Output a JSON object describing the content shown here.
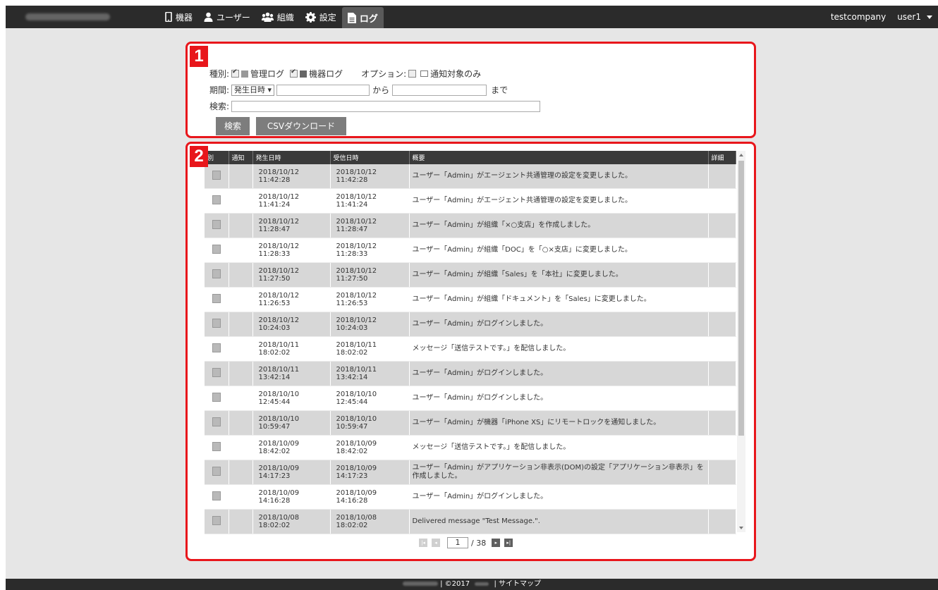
{
  "nav": {
    "items": [
      {
        "label": "機器",
        "icon": "phone-icon"
      },
      {
        "label": "ユーザー",
        "icon": "user-icon"
      },
      {
        "label": "組織",
        "icon": "group-icon"
      },
      {
        "label": "設定",
        "icon": "gear-icon"
      },
      {
        "label": "ログ",
        "icon": "document-icon"
      }
    ],
    "active": "ログ"
  },
  "user": {
    "company": "testcompany",
    "name": "user1"
  },
  "badges": {
    "panel1": "1",
    "panel2": "2"
  },
  "filter": {
    "type_label": "種別:",
    "admin_log": "管理ログ",
    "device_log": "機器ログ",
    "option_label": "オプション:",
    "notify_only": "通知対象のみ",
    "period_label": "期間:",
    "period_select": "発生日時",
    "from_label": "から",
    "to_label": "まで",
    "search_label": "検索:",
    "search_value": "",
    "search_button": "検索",
    "csv_button": "CSVダウンロード"
  },
  "table": {
    "headers": [
      "別",
      "通知",
      "発生日時",
      "受信日時",
      "概要",
      "詳細"
    ],
    "rows": [
      {
        "occ_date": "2018/10/12",
        "occ_time": "11:42:28",
        "rcv_date": "2018/10/12",
        "rcv_time": "11:42:28",
        "summary": "ユーザー「Admin」がエージェント共通管理の設定を変更しました。"
      },
      {
        "occ_date": "2018/10/12",
        "occ_time": "11:41:24",
        "rcv_date": "2018/10/12",
        "rcv_time": "11:41:24",
        "summary": "ユーザー「Admin」がエージェント共通管理の設定を変更しました。"
      },
      {
        "occ_date": "2018/10/12",
        "occ_time": "11:28:47",
        "rcv_date": "2018/10/12",
        "rcv_time": "11:28:47",
        "summary": "ユーザー「Admin」が組織「×○支店」を作成しました。"
      },
      {
        "occ_date": "2018/10/12",
        "occ_time": "11:28:33",
        "rcv_date": "2018/10/12",
        "rcv_time": "11:28:33",
        "summary": "ユーザー「Admin」が組織「DOC」を「○×支店」に変更しました。"
      },
      {
        "occ_date": "2018/10/12",
        "occ_time": "11:27:50",
        "rcv_date": "2018/10/12",
        "rcv_time": "11:27:50",
        "summary": "ユーザー「Admin」が組織「Sales」を「本社」に変更しました。"
      },
      {
        "occ_date": "2018/10/12",
        "occ_time": "11:26:53",
        "rcv_date": "2018/10/12",
        "rcv_time": "11:26:53",
        "summary": "ユーザー「Admin」が組織「ドキュメント」を「Sales」に変更しました。"
      },
      {
        "occ_date": "2018/10/12",
        "occ_time": "10:24:03",
        "rcv_date": "2018/10/12",
        "rcv_time": "10:24:03",
        "summary": "ユーザー「Admin」がログインしました。"
      },
      {
        "occ_date": "2018/10/11",
        "occ_time": "18:02:02",
        "rcv_date": "2018/10/11",
        "rcv_time": "18:02:02",
        "summary": "メッセージ「送信テストです。」を配信しました。"
      },
      {
        "occ_date": "2018/10/11",
        "occ_time": "13:42:14",
        "rcv_date": "2018/10/11",
        "rcv_time": "13:42:14",
        "summary": "ユーザー「Admin」がログインしました。"
      },
      {
        "occ_date": "2018/10/10",
        "occ_time": "12:45:44",
        "rcv_date": "2018/10/10",
        "rcv_time": "12:45:44",
        "summary": "ユーザー「Admin」がログインしました。"
      },
      {
        "occ_date": "2018/10/10",
        "occ_time": "10:59:47",
        "rcv_date": "2018/10/10",
        "rcv_time": "10:59:47",
        "summary": "ユーザー「Admin」が機器「iPhone XS」にリモートロックを通知しました。"
      },
      {
        "occ_date": "2018/10/09",
        "occ_time": "18:42:02",
        "rcv_date": "2018/10/09",
        "rcv_time": "18:42:02",
        "summary": "メッセージ「送信テストです。」を配信しました。"
      },
      {
        "occ_date": "2018/10/09",
        "occ_time": "14:17:23",
        "rcv_date": "2018/10/09",
        "rcv_time": "14:17:23",
        "summary": "ユーザー「Admin」がアプリケーション非表示(DOM)の設定「アプリケーション非表示」を作成しました。"
      },
      {
        "occ_date": "2018/10/09",
        "occ_time": "14:16:28",
        "rcv_date": "2018/10/09",
        "rcv_time": "14:16:28",
        "summary": "ユーザー「Admin」がログインしました。"
      },
      {
        "occ_date": "2018/10/08",
        "occ_time": "18:02:02",
        "rcv_date": "2018/10/08",
        "rcv_time": "18:02:02",
        "summary": "Delivered message \"Test Message.\"."
      }
    ]
  },
  "pager": {
    "current": "1",
    "total": "/ 38"
  },
  "footer": {
    "copyright": "| ©2017",
    "sitemap": "| サイトマップ"
  }
}
